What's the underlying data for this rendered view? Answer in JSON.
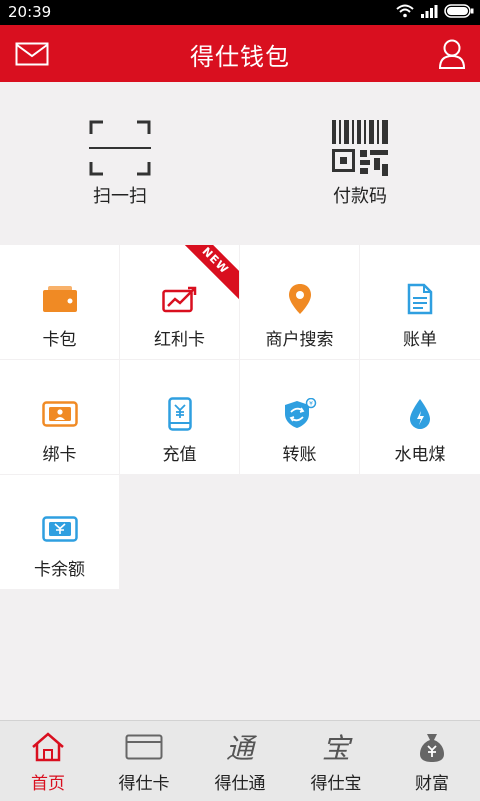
{
  "status": {
    "time": "20:39"
  },
  "header": {
    "title": "得仕钱包"
  },
  "quick": [
    {
      "label": "扫一扫",
      "icon": "scan-icon"
    },
    {
      "label": "付款码",
      "icon": "qr-code-icon"
    }
  ],
  "grid": [
    {
      "label": "卡包",
      "icon": "wallet-icon"
    },
    {
      "label": "红利卡",
      "icon": "trend-card-icon",
      "badge": "NEW"
    },
    {
      "label": "商户搜索",
      "icon": "location-pin-icon"
    },
    {
      "label": "账单",
      "icon": "bill-document-icon"
    },
    {
      "label": "绑卡",
      "icon": "bind-card-icon"
    },
    {
      "label": "充值",
      "icon": "phone-yuan-icon"
    },
    {
      "label": "转账",
      "icon": "transfer-shield-icon"
    },
    {
      "label": "水电煤",
      "icon": "water-drop-icon"
    },
    {
      "label": "卡余额",
      "icon": "card-balance-icon"
    }
  ],
  "tabs": [
    {
      "label": "首页",
      "icon": "home-icon",
      "active": true
    },
    {
      "label": "得仕卡",
      "icon": "card-icon"
    },
    {
      "label": "得仕通",
      "icon": "tong-glyph-icon",
      "glyph": "通"
    },
    {
      "label": "得仕宝",
      "icon": "bao-glyph-icon",
      "glyph": "宝"
    },
    {
      "label": "财富",
      "icon": "money-bag-icon"
    }
  ],
  "colors": {
    "brand": "#d90f1f",
    "orange": "#f08a24",
    "blue": "#2f9fe0"
  }
}
